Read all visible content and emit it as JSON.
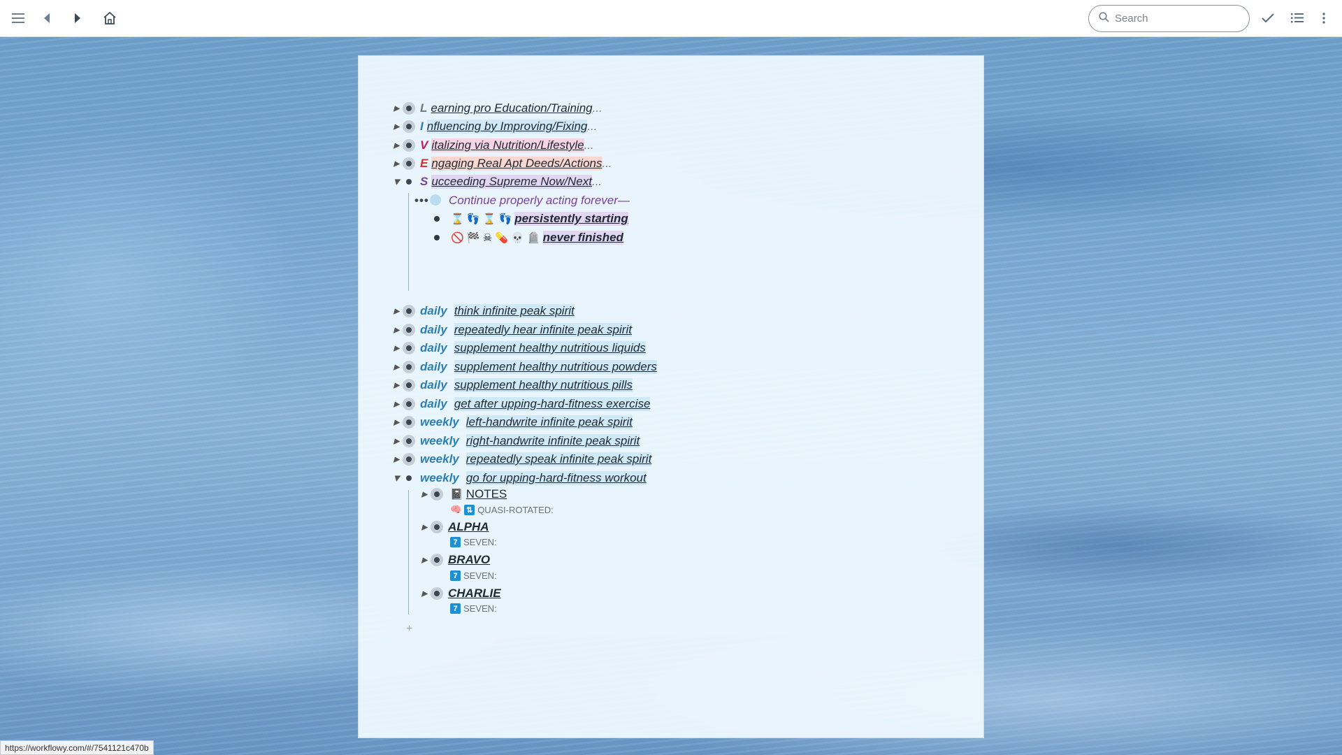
{
  "toolbar": {
    "search_placeholder": "Search",
    "icons": [
      "menu-icon",
      "back-icon",
      "forward-icon",
      "home-icon",
      "check-icon",
      "list-icon",
      "more-vertical-icon"
    ]
  },
  "outline": {
    "top_items": [
      {
        "letter": "L",
        "letter_color": "#6b7680",
        "text": "earning pro Education/Training",
        "ellipsis": "...",
        "highlight": "none"
      },
      {
        "letter": "I",
        "letter_color": "#2a7fb5",
        "text": "nfluencing by Improving/Fixing",
        "ellipsis": "...",
        "highlight": "blue"
      },
      {
        "letter": "V",
        "letter_color": "#c2185b",
        "text": "italizing via Nutrition/Lifestyle",
        "ellipsis": "...",
        "highlight": "pink"
      },
      {
        "letter": "E",
        "letter_color": "#d32f2f",
        "text": "ngaging Real Apt Deeds/Actions",
        "ellipsis": "...",
        "highlight": "salmon"
      },
      {
        "letter": "S",
        "letter_color": "#7b3fa0",
        "text": "ucceeding Supreme Now/Next",
        "ellipsis": "...",
        "highlight": "purple"
      }
    ],
    "continue_item": "Continue properly acting forever—",
    "persist_item": "persistently starting",
    "persist_emojis": "⌛ 👣 ⌛ 👣",
    "never_item": "never finished",
    "never_emojis": "🚫 🏁 ☠ 💊 💀 🪦",
    "daily_items": [
      {
        "tag": "daily",
        "text": "think infinite peak spirit"
      },
      {
        "tag": "daily",
        "text": "repeatedly hear infinite peak spirit"
      },
      {
        "tag": "daily",
        "text": "supplement healthy nutritious liquids"
      },
      {
        "tag": "daily",
        "text": "supplement healthy nutritious powders"
      },
      {
        "tag": "daily",
        "text": "supplement healthy nutritious pills"
      },
      {
        "tag": "daily",
        "text": "get after upping-hard-fitness exercise"
      },
      {
        "tag": "weekly",
        "text": "left-handwrite infinite peak spirit"
      },
      {
        "tag": "weekly",
        "text": "right-handwrite infinite peak spirit"
      },
      {
        "tag": "weekly",
        "text": "repeatedly speak infinite peak spirit"
      },
      {
        "tag": "weekly",
        "text": "go for upping-hard-fitness workout"
      }
    ],
    "children": [
      {
        "title": "NOTES",
        "note": "QUASI-ROTATED:",
        "note_badge": "⇅"
      },
      {
        "title": "ALPHA",
        "note": "SEVEN:",
        "note_badge": "7"
      },
      {
        "title": "BRAVO",
        "note": "SEVEN:",
        "note_badge": "7"
      },
      {
        "title": "CHARLIE",
        "note": "SEVEN:",
        "note_badge": "7"
      }
    ],
    "add_label": "+"
  },
  "status_url": "https://workflowy.com/#/7541121c470b"
}
